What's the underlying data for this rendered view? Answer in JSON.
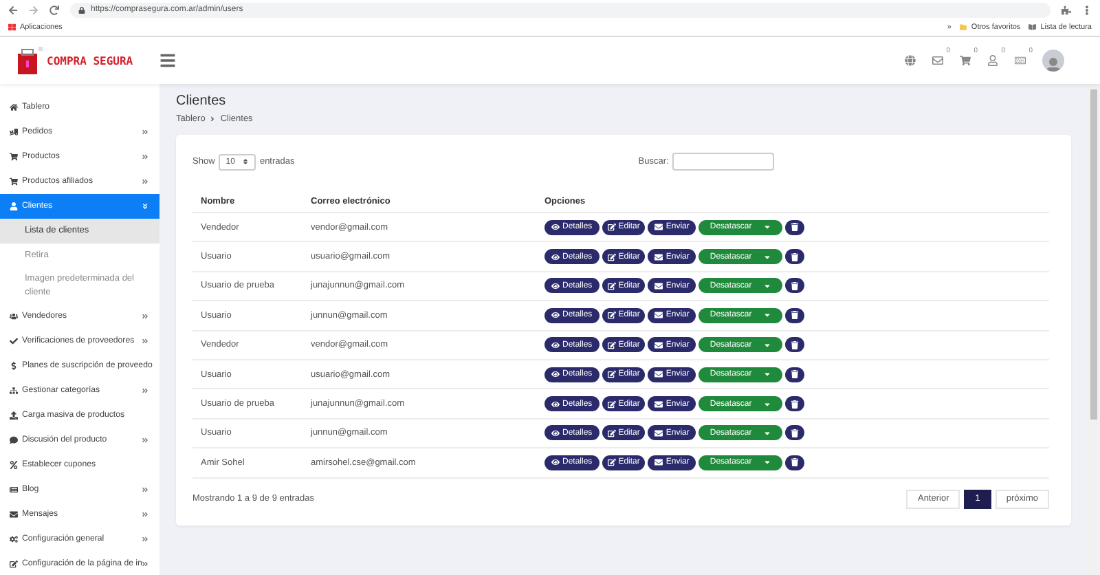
{
  "browser": {
    "url": "https://comprasegura.com.ar/admin/users",
    "bookmarks": [
      {
        "kind": "apps",
        "label": "Aplicaciones"
      },
      {
        "kind": "more",
        "label": "»"
      },
      {
        "kind": "folder",
        "label": "Otros favoritos"
      },
      {
        "kind": "reading",
        "label": "Lista de lectura"
      }
    ]
  },
  "header": {
    "logo": "COMPRA SEGURA",
    "notifications": [
      {
        "kind": "globe"
      },
      {
        "kind": "mail",
        "count": "0"
      },
      {
        "kind": "cart",
        "count": "0"
      },
      {
        "kind": "user",
        "count": "0"
      },
      {
        "kind": "card",
        "count": "0"
      }
    ]
  },
  "sidebar": {
    "items": [
      {
        "label": "Tablero",
        "arrow": false,
        "selected": false
      },
      {
        "label": "Pedidos",
        "arrow": true,
        "selected": false
      },
      {
        "label": "Productos",
        "arrow": true,
        "selected": false
      },
      {
        "label": "Productos afiliados",
        "arrow": true,
        "selected": false
      },
      {
        "label": "Clientes",
        "arrow": true,
        "selected": true,
        "expanded": true,
        "children": [
          {
            "label": "Lista de clientes",
            "selected": true
          },
          {
            "label": "Retira",
            "selected": false
          },
          {
            "label": "Imagen predeterminada del cliente",
            "selected": false
          }
        ]
      },
      {
        "label": "Vendedores",
        "arrow": true,
        "selected": false
      },
      {
        "label": "Verificaciones de proveedores",
        "arrow": true,
        "selected": false
      },
      {
        "label": "Planes de suscripción de proveedo",
        "arrow": false,
        "selected": false
      },
      {
        "label": "Gestionar categorías",
        "arrow": true,
        "selected": false
      },
      {
        "label": "Carga masiva de productos",
        "arrow": false,
        "selected": false
      },
      {
        "label": "Discusión del producto",
        "arrow": true,
        "selected": false
      },
      {
        "label": "Establecer cupones",
        "arrow": false,
        "selected": false
      },
      {
        "label": "Blog",
        "arrow": true,
        "selected": false
      },
      {
        "label": "Mensajes",
        "arrow": true,
        "selected": false
      },
      {
        "label": "Configuración general",
        "arrow": true,
        "selected": false
      },
      {
        "label": "Configuración de la página de in",
        "arrow": true,
        "selected": false
      }
    ]
  },
  "page": {
    "title": "Clientes",
    "breadcrumb": [
      "Tablero",
      "Clientes"
    ]
  },
  "table": {
    "show_label": "Show",
    "page_size": "10",
    "entries_label": "entradas",
    "search_label": "Buscar:",
    "columns": [
      "Nombre",
      "Correo electrónico",
      "Opciones"
    ],
    "rows": [
      {
        "name": "Vendedor",
        "email": "vendor@gmail.com",
        "actions": [
          {
            "kind": "details",
            "label": "Detalles"
          },
          {
            "kind": "edit",
            "label": "Editar"
          },
          {
            "kind": "send",
            "label": "Enviar"
          },
          {
            "kind": "dropdown",
            "label": "Desatascar"
          },
          {
            "kind": "delete"
          }
        ]
      },
      {
        "name": "Usuario",
        "email": "usuario@gmail.com",
        "actions": [
          {
            "kind": "details",
            "label": "Detalles"
          },
          {
            "kind": "edit",
            "label": "Editar"
          },
          {
            "kind": "send",
            "label": "Enviar"
          },
          {
            "kind": "dropdown",
            "label": "Desatascar"
          },
          {
            "kind": "delete"
          }
        ]
      },
      {
        "name": "Usuario de prueba",
        "email": "junajunnun@gmail.com",
        "actions": [
          {
            "kind": "details",
            "label": "Detalles"
          },
          {
            "kind": "edit",
            "label": "Editar"
          },
          {
            "kind": "send",
            "label": "Enviar"
          },
          {
            "kind": "dropdown",
            "label": "Desatascar"
          },
          {
            "kind": "delete"
          }
        ]
      },
      {
        "name": "Usuario",
        "email": "junnun@gmail.com",
        "actions": [
          {
            "kind": "details",
            "label": "Detalles"
          },
          {
            "kind": "edit",
            "label": "Editar"
          },
          {
            "kind": "send",
            "label": "Enviar"
          },
          {
            "kind": "dropdown",
            "label": "Desatascar"
          },
          {
            "kind": "delete"
          }
        ]
      },
      {
        "name": "Vendedor",
        "email": "vendor@gmail.com",
        "actions": [
          {
            "kind": "details",
            "label": "Detalles"
          },
          {
            "kind": "edit",
            "label": "Editar"
          },
          {
            "kind": "send",
            "label": "Enviar"
          },
          {
            "kind": "dropdown",
            "label": "Desatascar"
          },
          {
            "kind": "delete"
          }
        ]
      },
      {
        "name": "Usuario",
        "email": "usuario@gmail.com",
        "actions": [
          {
            "kind": "details",
            "label": "Detalles"
          },
          {
            "kind": "edit",
            "label": "Editar"
          },
          {
            "kind": "send",
            "label": "Enviar"
          },
          {
            "kind": "dropdown",
            "label": "Desatascar"
          },
          {
            "kind": "delete"
          }
        ]
      },
      {
        "name": "Usuario de prueba",
        "email": "junajunnun@gmail.com",
        "actions": [
          {
            "kind": "details",
            "label": "Detalles"
          },
          {
            "kind": "edit",
            "label": "Editar"
          },
          {
            "kind": "send",
            "label": "Enviar"
          },
          {
            "kind": "dropdown",
            "label": "Desatascar"
          },
          {
            "kind": "delete"
          }
        ]
      },
      {
        "name": "Usuario",
        "email": "junnun@gmail.com",
        "actions": [
          {
            "kind": "details",
            "label": "Detalles"
          },
          {
            "kind": "edit",
            "label": "Editar"
          },
          {
            "kind": "send",
            "label": "Enviar"
          },
          {
            "kind": "dropdown",
            "label": "Desatascar"
          },
          {
            "kind": "delete"
          }
        ]
      },
      {
        "name": "Amir Sohel",
        "email": "amirsohel.cse@gmail.com",
        "actions": [
          {
            "kind": "details",
            "label": "Detalles"
          },
          {
            "kind": "edit",
            "label": "Editar"
          },
          {
            "kind": "send",
            "label": "Enviar"
          },
          {
            "kind": "dropdown",
            "label": "Desatascar"
          },
          {
            "kind": "delete"
          }
        ]
      }
    ],
    "info": "Mostrando 1 a 9 de 9 entradas",
    "pagination": [
      {
        "label": "Anterior",
        "selected": false
      },
      {
        "label": "1",
        "selected": true
      },
      {
        "label": "próximo",
        "selected": false
      }
    ]
  }
}
